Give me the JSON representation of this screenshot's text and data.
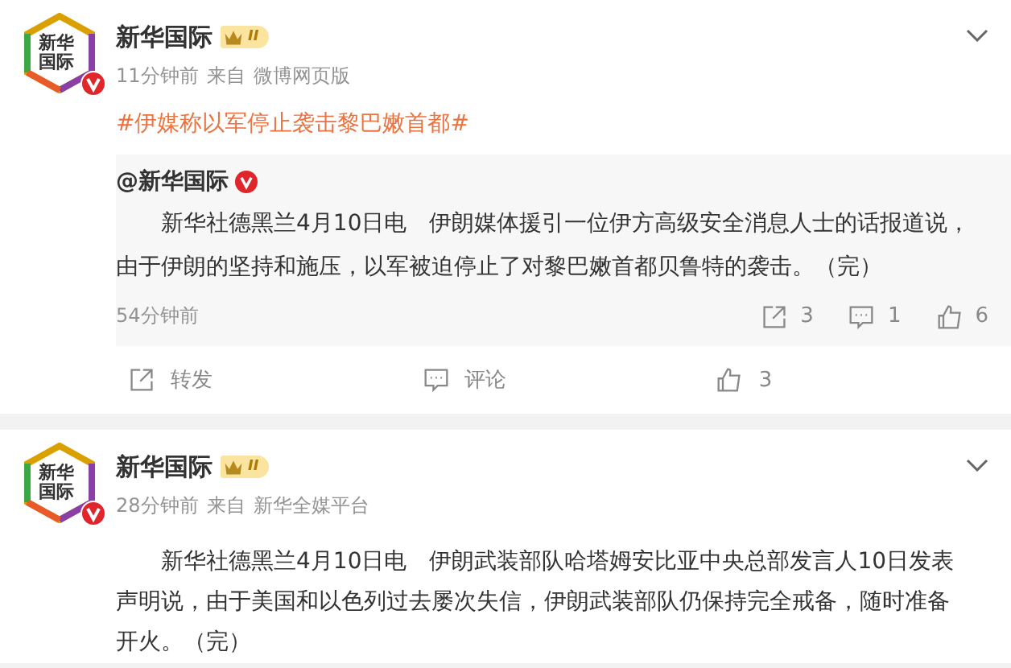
{
  "posts": [
    {
      "author": "新华国际",
      "avatar_lines": [
        "新华",
        "国际"
      ],
      "verified": true,
      "badge": "II",
      "time": "11分钟前",
      "source_prefix": "来自",
      "source": "微博网页版",
      "topic": "#伊媒称以军停止袭击黎巴嫩首都#",
      "repost": {
        "author": "@新华国际",
        "verified": true,
        "text": "新华社德黑兰4月10日电　伊朗媒体援引一位伊方高级安全消息人士的话报道说，由于伊朗的坚持和施压，以军被迫停止了对黎巴嫩首都贝鲁特的袭击。（完）",
        "time": "54分钟前",
        "reposts": "3",
        "comments": "1",
        "likes": "6"
      },
      "actions": {
        "repost": "转发",
        "comment": "评论",
        "likes": "3"
      }
    },
    {
      "author": "新华国际",
      "avatar_lines": [
        "新华",
        "国际"
      ],
      "verified": true,
      "badge": "II",
      "time": "28分钟前",
      "source_prefix": "来自",
      "source": "新华全媒平台",
      "text": "新华社德黑兰4月10日电　伊朗武装部队哈塔姆安比亚中央总部发言人10日发表声明说，由于美国和以色列过去屡次失信，伊朗武装部队仍保持完全戒备，随时准备开火。（完）"
    }
  ]
}
